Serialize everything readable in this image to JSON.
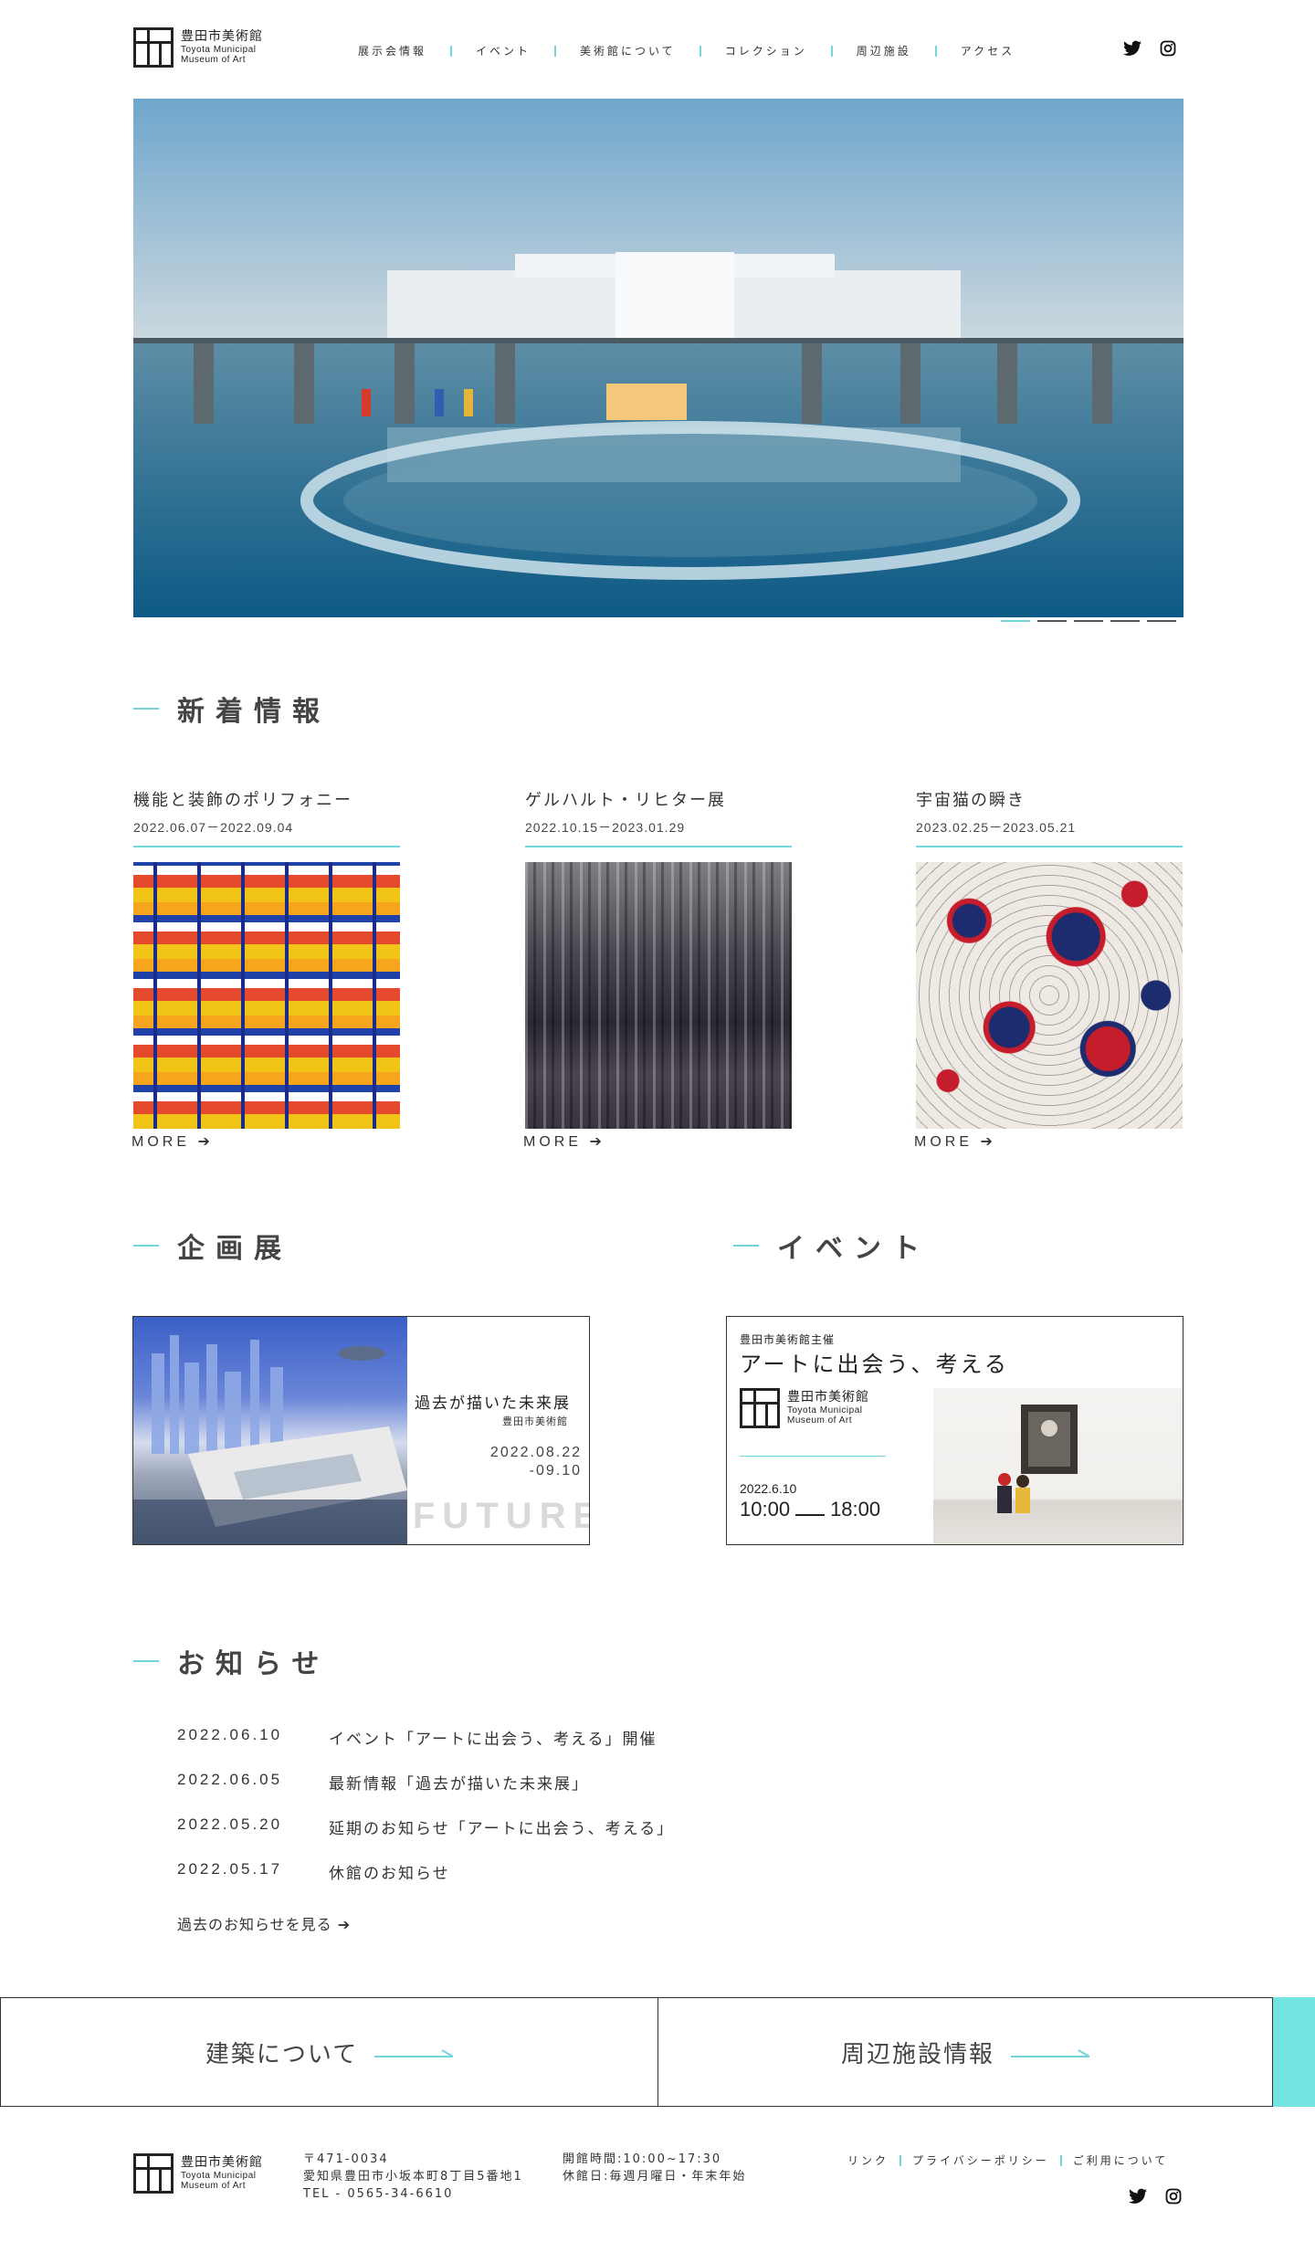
{
  "header": {
    "logo_jp": "豊田市美術館",
    "logo_en_line1": "Toyota Municipal",
    "logo_en_line2": "Museum of Art",
    "nav": [
      "展示会情報",
      "イベント",
      "美術館について",
      "コレクション",
      "周辺施設",
      "アクセス"
    ],
    "social": [
      "twitter-icon",
      "instagram-icon"
    ]
  },
  "hero": {
    "slide_count": 5,
    "active_slide": 1
  },
  "news": {
    "title": "新着情報",
    "items": [
      {
        "title": "機能と装飾のポリフォニー",
        "date": "2022.06.07－2022.09.04",
        "more": "MORE"
      },
      {
        "title": "ゲルハルト・リヒター展",
        "date": "2022.10.15－2023.01.29",
        "more": "MORE"
      },
      {
        "title": "宇宙猫の瞬き",
        "date": "2023.02.25－2023.05.21",
        "more": "MORE"
      }
    ]
  },
  "exhibition": {
    "title": "企画展",
    "banner_title": "過去が描いた未来展",
    "banner_sub": "豊田市美術館",
    "banner_date1": "2022.08.22",
    "banner_date2": "-09.10",
    "banner_word": "FUTURE"
  },
  "event": {
    "title": "イベント",
    "organizer": "豊田市美術館主催",
    "banner_title": "アートに出会う、考える",
    "logo_jp": "豊田市美術館",
    "logo_en_line1": "Toyota Municipal",
    "logo_en_line2": "Museum of Art",
    "date": "2022.6.10",
    "time_start": "10:00",
    "time_end": "18:00"
  },
  "notices": {
    "title": "お知らせ",
    "items": [
      {
        "date": "2022.06.10",
        "text": "イベント「アートに出会う、考える」開催"
      },
      {
        "date": "2022.06.05",
        "text": "最新情報「過去が描いた未来展」"
      },
      {
        "date": "2022.05.20",
        "text": "延期のお知らせ「アートに出会う、考える」"
      },
      {
        "date": "2022.05.17",
        "text": "休館のお知らせ"
      }
    ],
    "more": "過去のお知らせを見る"
  },
  "bottom_links": {
    "architecture": "建築について",
    "nearby": "周辺施設情報"
  },
  "footer": {
    "logo_jp": "豊田市美術館",
    "logo_en_line1": "Toyota Municipal",
    "logo_en_line2": "Museum of Art",
    "postal": "〒471-0034",
    "address": "愛知県豊田市小坂本町8丁目5番地1",
    "tel": "TEL - 0565-34-6610",
    "hours": "開館時間:10:00~17:30",
    "closed": "休館日:毎週月曜日・年末年始",
    "links": [
      "リンク",
      "プライバシーポリシー",
      "ご利用について"
    ]
  },
  "colors": {
    "accent": "#6fd6db",
    "accent_strip": "#73e3e1",
    "text": "#333333"
  }
}
